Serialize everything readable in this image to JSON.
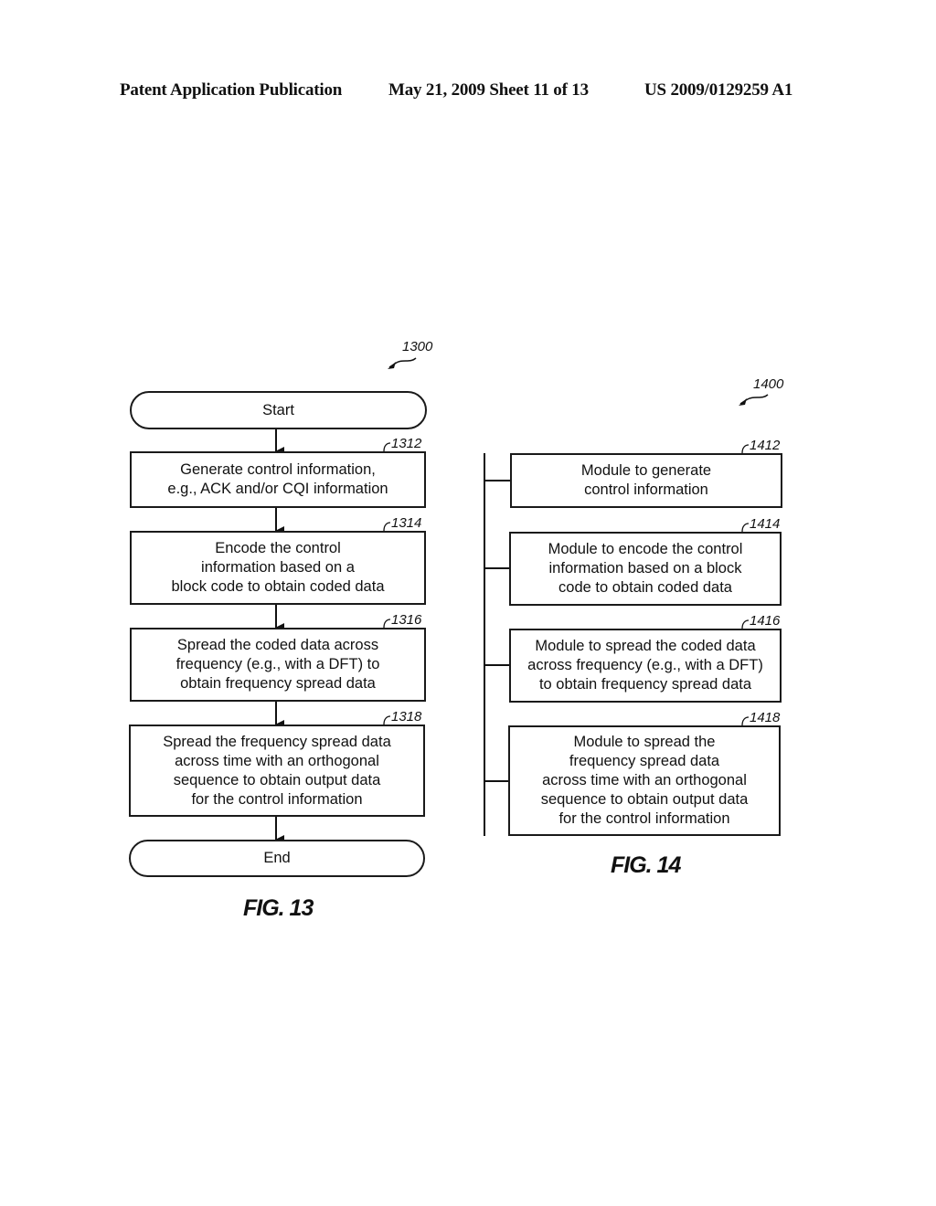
{
  "header": {
    "publication": "Patent Application Publication",
    "date_sheet": "May 21, 2009  Sheet 11 of 13",
    "patent_number": "US 2009/0129259 A1"
  },
  "fig13": {
    "ref": "1300",
    "start": "Start",
    "end": "End",
    "caption": "FIG. 13",
    "steps": [
      {
        "ref": "1312",
        "text": "Generate control information,\ne.g., ACK and/or CQI information"
      },
      {
        "ref": "1314",
        "text": "Encode the control\ninformation based on a\nblock code to obtain coded data"
      },
      {
        "ref": "1316",
        "text": "Spread the coded data across\nfrequency (e.g., with a DFT) to\nobtain frequency spread data"
      },
      {
        "ref": "1318",
        "text": "Spread the frequency spread data\nacross time with an orthogonal\nsequence to obtain output data\nfor the control information"
      }
    ]
  },
  "fig14": {
    "ref": "1400",
    "caption": "FIG. 14",
    "modules": [
      {
        "ref": "1412",
        "text": "Module to generate\ncontrol information"
      },
      {
        "ref": "1414",
        "text": "Module to encode the control\ninformation based on a block\ncode to obtain coded data"
      },
      {
        "ref": "1416",
        "text": "Module to spread the coded data\nacross frequency (e.g., with a DFT)\nto obtain frequency spread data"
      },
      {
        "ref": "1418",
        "text": "Module to spread the\nfrequency spread data\nacross time with an orthogonal\nsequence to obtain output data\nfor the control information"
      }
    ]
  }
}
